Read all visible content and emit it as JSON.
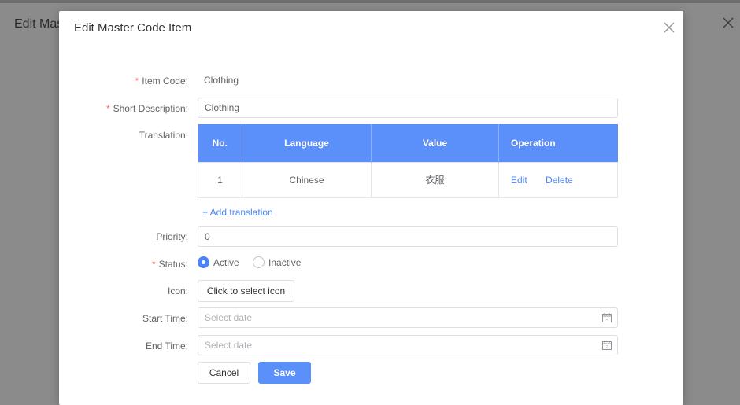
{
  "background": {
    "title": "Edit Mas"
  },
  "modal": {
    "title": "Edit Master Code Item"
  },
  "form": {
    "item_code": {
      "label": "Item Code:",
      "value": "Clothing",
      "required": "*"
    },
    "short_description": {
      "label": "Short Description:",
      "value": "Clothing",
      "required": "*"
    },
    "translation": {
      "label": "Translation:",
      "columns": [
        "No.",
        "Language",
        "Value",
        "Operation"
      ],
      "rows": [
        {
          "no": "1",
          "language": "Chinese",
          "value": "衣服",
          "edit": "Edit",
          "delete": "Delete"
        }
      ],
      "add_label": "+ Add translation"
    },
    "priority": {
      "label": "Priority:",
      "value": "0"
    },
    "status": {
      "label": "Status:",
      "required": "*",
      "options": [
        "Active",
        "Inactive"
      ],
      "selected": "Active"
    },
    "icon": {
      "label": "Icon:",
      "button": "Click to select icon"
    },
    "start_time": {
      "label": "Start Time:",
      "placeholder": "Select date"
    },
    "end_time": {
      "label": "End Time:",
      "placeholder": "Select date"
    }
  },
  "actions": {
    "cancel": "Cancel",
    "save": "Save"
  },
  "colors": {
    "primary": "#5b8ff9",
    "link": "#4a84f7",
    "required": "#f56c6c",
    "overlay": "#8c8c8c"
  }
}
